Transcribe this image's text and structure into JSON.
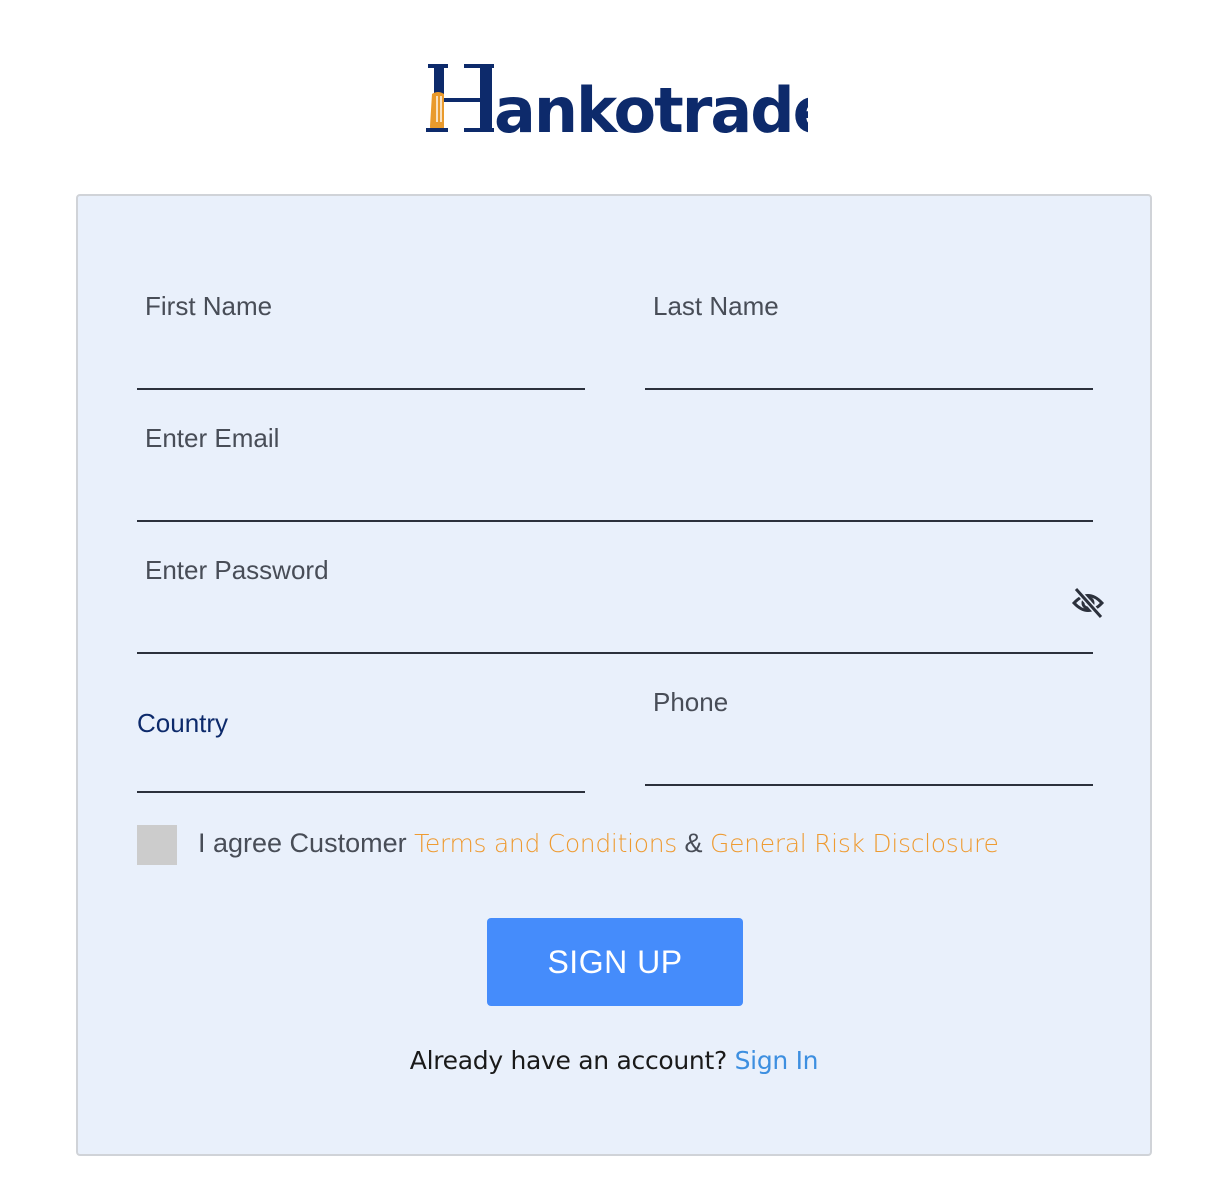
{
  "brand": {
    "logo_text": "Hankotrade",
    "colors": {
      "navy": "#0d2a6b",
      "orange": "#e99a2c"
    }
  },
  "form": {
    "first_name": {
      "label": "First Name",
      "value": ""
    },
    "last_name": {
      "label": "Last Name",
      "value": ""
    },
    "email": {
      "label": "Enter Email",
      "value": ""
    },
    "password": {
      "label": "Enter Password",
      "value": "",
      "toggle_icon": "eye-off-icon"
    },
    "country": {
      "label": "Country",
      "value": ""
    },
    "phone": {
      "label": "Phone",
      "value": ""
    },
    "agreement": {
      "checked": false,
      "prefix": "I agree Customer",
      "terms_link": "Terms and Conditions",
      "separator": "&",
      "risk_link": "General Risk Disclosure"
    },
    "submit_label": "SIGN UP",
    "footer": {
      "prompt": "Already have an account?",
      "signin_link": "Sign In"
    }
  },
  "colors": {
    "card_bg": "#e9f0fb",
    "button_bg": "#458cfb",
    "link_orange": "#ee9b32",
    "link_blue": "#3d8fe0",
    "label_active": "#0d2a6b"
  }
}
